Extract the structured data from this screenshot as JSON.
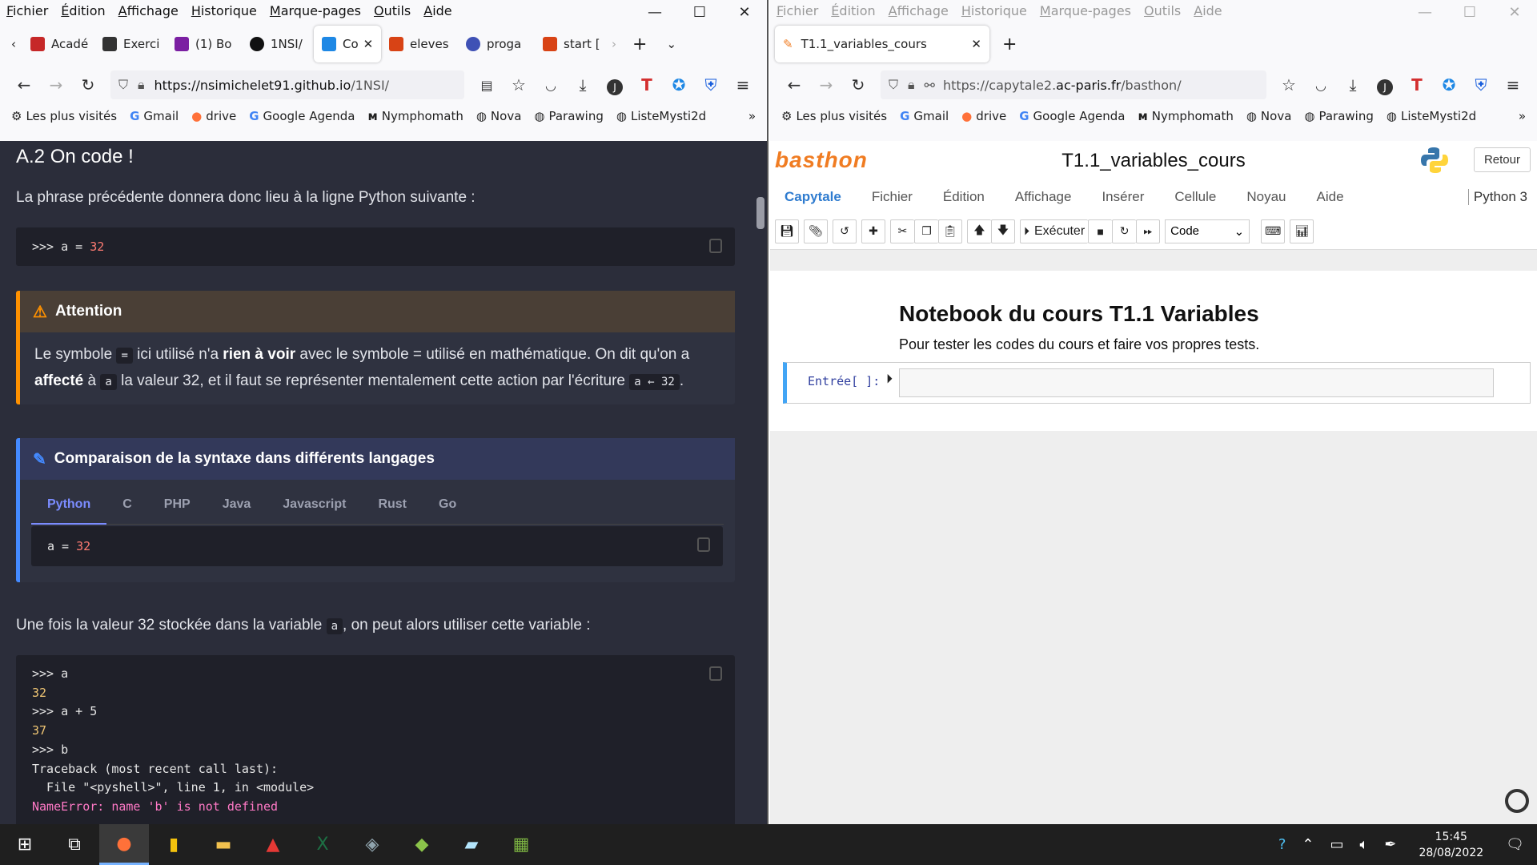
{
  "left": {
    "menu": [
      "Fichier",
      "Édition",
      "Affichage",
      "Historique",
      "Marque-pages",
      "Outils",
      "Aide"
    ],
    "tabs": [
      {
        "label": "Acadé",
        "color": "#c62828"
      },
      {
        "label": "Exerci",
        "color": "#333333"
      },
      {
        "label": "(1) Bo",
        "color": "#7b1fa2"
      },
      {
        "label": "1NSI/",
        "color": "#111111"
      },
      {
        "label": "Co",
        "color": "#1e88e5"
      },
      {
        "label": "eleves",
        "color": "#d84315"
      },
      {
        "label": "proga",
        "color": "#3f51b5"
      },
      {
        "label": "start [",
        "color": "#d84315"
      }
    ],
    "url_host": "https://nsimichelet91.github.io",
    "url_path": "/1NSI/",
    "bookmarks": [
      "Les plus visités",
      "Gmail",
      "drive",
      "Google Agenda",
      "Nymphomath",
      "Nova",
      "Parawing",
      "ListeMysti2d"
    ],
    "doc": {
      "heading": "A.2 On code !",
      "intro": "La phrase précédente donnera donc lieu à la ligne Python suivante :",
      "code1_prefix": ">>> a = ",
      "code1_num": "32",
      "attention_title": "Attention",
      "attention_p1": "Le symbole ",
      "attention_eq": "=",
      "attention_p2": " ici utilisé n'a ",
      "attention_b1": "rien à voir",
      "attention_p3": " avec le symbole = utilisé en mathématique. On dit qu'on a ",
      "attention_b2": "affecté",
      "attention_p4": " à ",
      "attention_a": "a",
      "attention_p5": " la valeur 32, et il faut se représenter mentalement cette action par l'écriture ",
      "attention_arrow": "a ← 32",
      "attention_p6": ".",
      "compare_title": "Comparaison de la syntaxe dans différents langages",
      "lang_tabs": [
        "Python",
        "C",
        "PHP",
        "Java",
        "Javascript",
        "Rust",
        "Go"
      ],
      "code2_prefix": "a = ",
      "code2_num": "32",
      "after_p1": "Une fois la valeur 32 stockée dans la variable ",
      "after_var": "a",
      "after_p2": ", on peut alors utiliser cette variable :",
      "console": [
        ">>> a",
        "32",
        ">>> a + 5",
        "37",
        ">>> b",
        "Traceback (most recent call last):",
        "  File \"<pyshell>\", line 1, in <module>",
        "NameError: name 'b' is not defined"
      ]
    }
  },
  "right": {
    "menu": [
      "Fichier",
      "Édition",
      "Affichage",
      "Historique",
      "Marque-pages",
      "Outils",
      "Aide"
    ],
    "tab_label": "T1.1_variables_cours",
    "url_prefix": "https://capytale2.",
    "url_host": "ac-paris.fr",
    "url_path": "/basthon/",
    "bookmarks": [
      "Les plus visités",
      "Gmail",
      "drive",
      "Google Agenda",
      "Nymphomath",
      "Nova",
      "Parawing",
      "ListeMysti2d"
    ],
    "logo": "basthon",
    "notebook_title": "T1.1_variables_cours",
    "retour": "Retour",
    "menu2": [
      "Capytale",
      "Fichier",
      "Édition",
      "Affichage",
      "Insérer",
      "Cellule",
      "Noyau",
      "Aide"
    ],
    "kernel": "Python 3",
    "run_label": "Exécuter",
    "cell_type": "Code",
    "md_title": "Notebook du cours T1.1 Variables",
    "md_text": "Pour tester les codes du cours et faire vos propres tests.",
    "prompt": "Entrée[ ]:"
  },
  "taskbar": {
    "time": "15:45",
    "date": "28/08/2022"
  }
}
